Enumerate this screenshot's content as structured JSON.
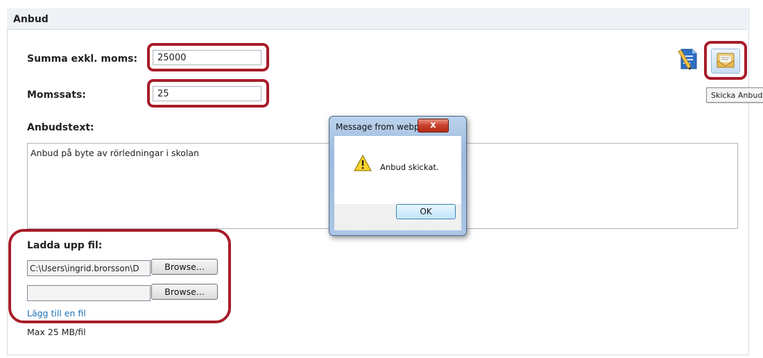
{
  "panel": {
    "title": "Anbud"
  },
  "form": {
    "sum_label": "Summa exkl. moms:",
    "sum_value": "25000",
    "vat_label": "Momssats:",
    "vat_value": "25",
    "text_label": "Anbudstext:",
    "text_value": "Anbud på byte av rörledningar i skolan"
  },
  "upload": {
    "label": "Ladda upp fil:",
    "files": [
      {
        "path": "C:\\Users\\ingrid.brorsson\\D",
        "button": "Browse..."
      },
      {
        "path": "",
        "button": "Browse..."
      }
    ],
    "add_link": "Lägg till en fil",
    "max_text": "Max 25 MB/fil"
  },
  "toolbar": {
    "tooltip": "Skicka Anbud",
    "icons": [
      "edit-document-icon",
      "send-envelope-icon"
    ]
  },
  "dialog": {
    "title": "Message from webpage",
    "close_label": "x",
    "message": "Anbud skickat.",
    "ok_label": "OK",
    "icon": "warning-icon"
  },
  "colors": {
    "highlight_ring": "#a81c28",
    "link": "#1a6fb5",
    "panel_border": "#d6dde6"
  }
}
